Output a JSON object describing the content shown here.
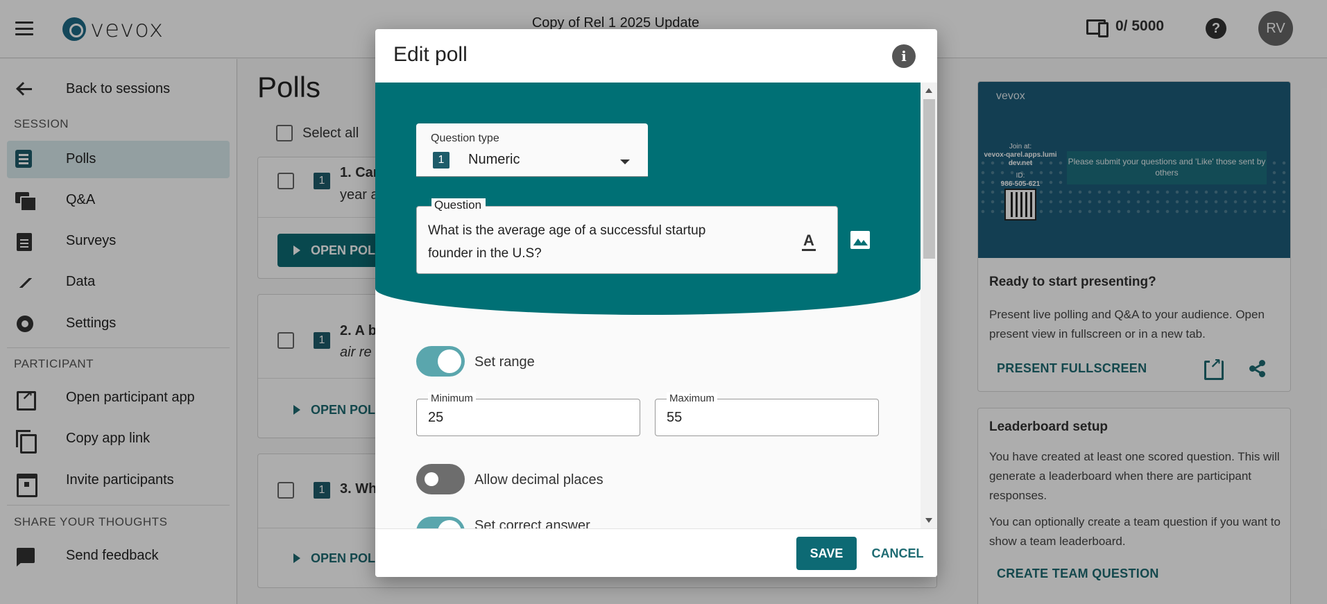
{
  "header": {
    "logo_text": "vevox",
    "session_title": "Copy of Rel 1 2025 Update",
    "participant_count": "0/ 5000",
    "help_glyph": "?",
    "avatar_initials": "RV"
  },
  "sidebar": {
    "back_label": "Back to sessions",
    "session_heading": "SESSION",
    "session_items": [
      {
        "label": "Polls",
        "icon": "polls-icon",
        "active": true
      },
      {
        "label": "Q&A",
        "icon": "qa-icon"
      },
      {
        "label": "Surveys",
        "icon": "surveys-icon"
      },
      {
        "label": "Data",
        "icon": "data-icon"
      },
      {
        "label": "Settings",
        "icon": "gear-icon"
      }
    ],
    "participant_heading": "PARTICIPANT",
    "participant_items": [
      {
        "label": "Open participant app",
        "icon": "open-in-new-icon"
      },
      {
        "label": "Copy app link",
        "icon": "copy-icon"
      },
      {
        "label": "Invite participants",
        "icon": "calendar-icon"
      }
    ],
    "thoughts_heading": "SHARE YOUR THOUGHTS",
    "thoughts_items": [
      {
        "label": "Send feedback",
        "icon": "feedback-icon"
      }
    ]
  },
  "main": {
    "title": "Polls",
    "select_all_label": "Select all",
    "polls": [
      {
        "number": "1",
        "question_line1": "1. Car",
        "question_line2": "year a",
        "open_label": "OPEN POL"
      },
      {
        "number": "1",
        "question_line1": "2. A b",
        "subtitle": "air re",
        "open_label": "OPEN POL"
      },
      {
        "number": "1",
        "question_line1": "3. Wh",
        "open_label": "OPEN POL"
      }
    ]
  },
  "present_card": {
    "preview": {
      "logo": "vevox",
      "join_at": "Join at:",
      "join_url": "vevox-qarel.apps.lumi dev.net",
      "id_label": "ID:",
      "id_value": "986-505-621",
      "message": "Please submit your questions and 'Like' those sent by others"
    },
    "heading": "Ready to start presenting?",
    "text": "Present live polling and Q&A to your audience. Open present view in fullscreen or in a new tab.",
    "fullscreen_label": "PRESENT FULLSCREEN"
  },
  "leaderboard_card": {
    "heading": "Leaderboard setup",
    "text1": "You have created at least one scored question. This will generate a leaderboard when there are participant responses.",
    "text2": "You can optionally create a team question if you want to show a team leaderboard.",
    "create_label": "CREATE TEAM QUESTION"
  },
  "modal": {
    "title": "Edit poll",
    "info_glyph": "i",
    "question_type_label": "Question type",
    "question_type_badge": "1",
    "question_type_value": "Numeric",
    "question_label": "Question",
    "question_text": "What is the average age of a successful startup founder in the U.S?",
    "format_glyph": "A",
    "set_range": {
      "label": "Set range",
      "on": true
    },
    "minimum": {
      "label": "Minimum",
      "value": "25"
    },
    "maximum": {
      "label": "Maximum",
      "value": "55"
    },
    "allow_decimal": {
      "label": "Allow decimal places",
      "on": false
    },
    "set_correct": {
      "label": "Set correct answer",
      "on": true
    },
    "save_label": "SAVE",
    "cancel_label": "CANCEL"
  },
  "colors": {
    "teal": "#007075",
    "accent_button": "#0d6a74",
    "toggle_on": "#5aa6ad",
    "toggle_off": "#6d6d6d"
  }
}
